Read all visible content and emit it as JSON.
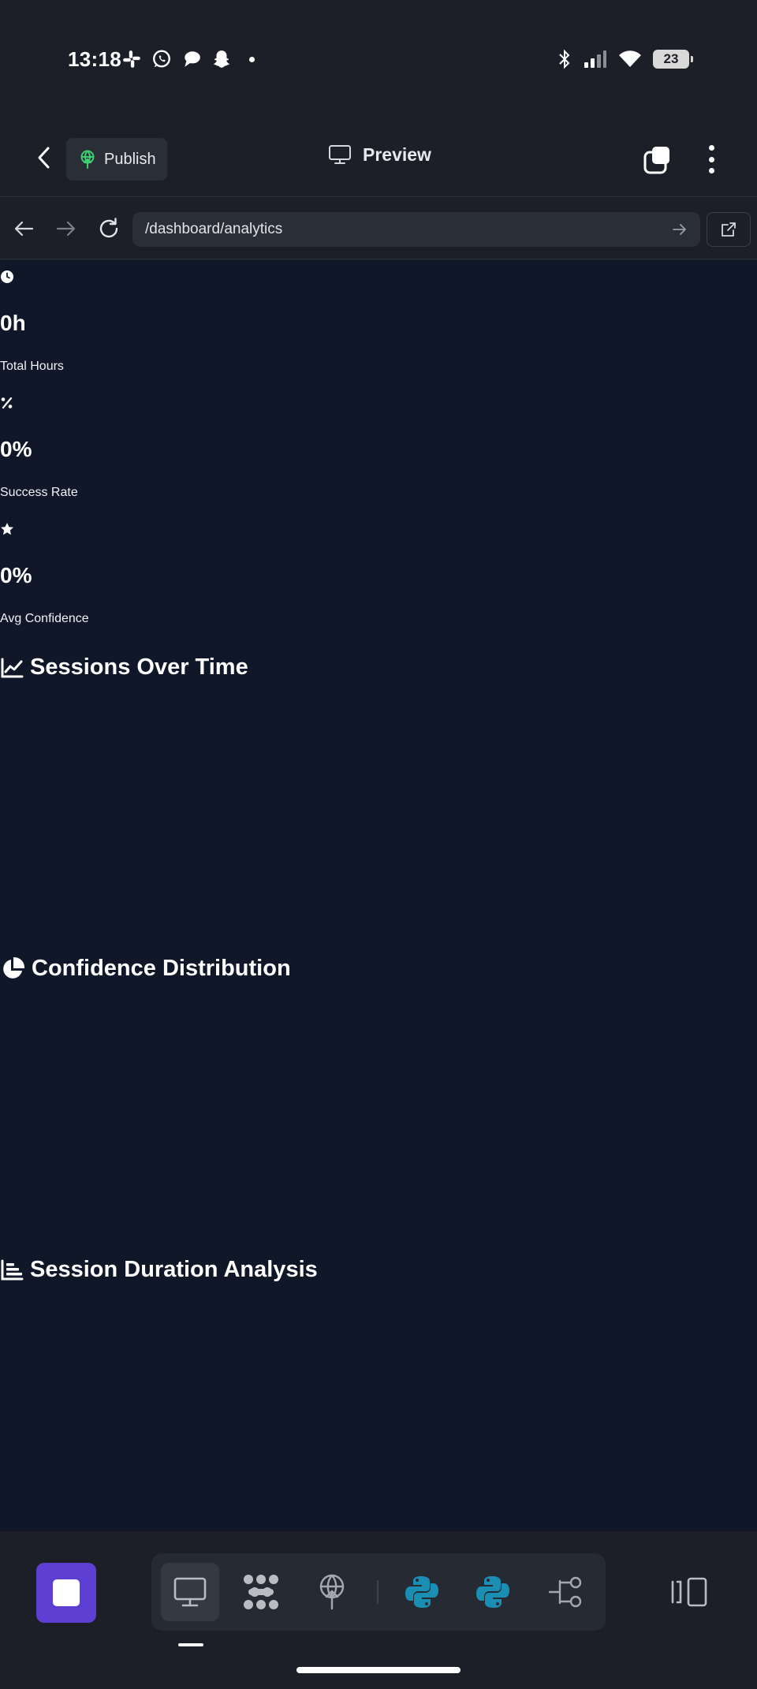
{
  "status_bar": {
    "time": "13:18",
    "left_icons": [
      "slack-icon",
      "whatsapp-icon",
      "chat-bubble-icon",
      "snapchat-icon"
    ],
    "right_icons": [
      "bluetooth-icon",
      "signal-icon",
      "wifi-icon"
    ],
    "battery": "23"
  },
  "header": {
    "publish_label": "Publish",
    "title": "Preview"
  },
  "url_bar": {
    "url": "/dashboard/analytics"
  },
  "stats": [
    {
      "icon": "clock-icon",
      "value": "0h",
      "label": "Total Hours"
    },
    {
      "icon": "percent-icon",
      "value": "0%",
      "label": "Success Rate"
    },
    {
      "icon": "star-icon",
      "value": "0%",
      "label": "Avg Confidence"
    }
  ],
  "sections": [
    {
      "icon": "line-chart-icon",
      "title": "Sessions Over Time"
    },
    {
      "icon": "pie-chart-icon",
      "title": "Confidence Distribution"
    },
    {
      "icon": "bar-chart-icon",
      "title": "Session Duration Analysis"
    }
  ],
  "toolbar": {
    "tools": [
      "monitor-icon",
      "dots-grid-icon",
      "publish-antenna-icon",
      "python-icon",
      "python-icon",
      "git-branch-icon"
    ],
    "active_tool": "monitor-icon"
  },
  "colors": {
    "page_background": "#101729",
    "chrome_background": "#1c1f27",
    "stop_button": "#5d3fd3",
    "python_icon": "#1a8fb3",
    "publish_icon": "#3ecf73"
  }
}
